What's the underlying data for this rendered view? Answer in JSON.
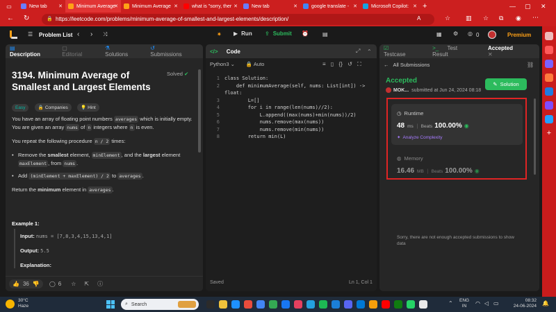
{
  "tabs": [
    {
      "label": "New tab",
      "fav": "#6b7cff"
    },
    {
      "label": "Minimum Average",
      "fav": "#ffa116",
      "active": true
    },
    {
      "label": "Minimum Average",
      "fav": "#ffa116"
    },
    {
      "label": "what is \"sorry, ther",
      "fav": "#ff0000"
    },
    {
      "label": "New tab",
      "fav": "#6b7cff"
    },
    {
      "label": "google translate -",
      "fav": "#4285f4"
    },
    {
      "label": "Microsoft Copilot:",
      "fav": "#17a2e0"
    }
  ],
  "address": {
    "url": "https://leetcode.com/problems/minimum-average-of-smallest-and-largest-elements/description/"
  },
  "nav": {
    "problem_list": "Problem List",
    "run": "Run",
    "submit": "Submit",
    "streak": "0",
    "premium": "Premium"
  },
  "desc_tabs": {
    "description": "Description",
    "editorial": "Editorial",
    "solutions": "Solutions",
    "submissions": "Submissions"
  },
  "problem": {
    "title_line1": "3194. Minimum Average of",
    "title_line2": "Smallest and Largest Elements",
    "solved": "Solved",
    "difficulty": "Easy",
    "companies": "Companies",
    "hint": "Hint",
    "p1a": "You have an array of floating point numbers ",
    "p1b": "averages",
    "p1c": " which is initially empty. You are given an array ",
    "p1d": "nums",
    "p1e": " of ",
    "p1f": "n",
    "p1g": " integers where ",
    "p1h": "n",
    "p1i": " is even.",
    "p2a": "You repeat the following procedure ",
    "p2b": "n / 2",
    "p2c": " times:",
    "b1a": "Remove the ",
    "b1b": "smallest",
    "b1c": " element, ",
    "b1d": "minElement",
    "b1e": ", and the ",
    "b1f": "largest",
    "b1g": " element ",
    "b1h": "maxElement",
    "b1i": ", from ",
    "b1j": "nums",
    "b1k": ".",
    "b2a": "Add ",
    "b2b": "(minElement + maxElement) / 2",
    "b2c": " to ",
    "b2d": "averages",
    "b2e": ".",
    "p3a": "Return the ",
    "p3b": "minimum",
    "p3c": " element in ",
    "p3d": "averages",
    "p3e": ".",
    "example": "Example 1:",
    "input_label": "Input:",
    "input_val": "nums = [7,8,3,4,15,13,4,1]",
    "output_label": "Output:",
    "output_val": "5.5",
    "explanation": "Explanation:",
    "likes": "36",
    "comments": "6"
  },
  "code": {
    "tab": "Code",
    "lang": "Python3",
    "auto": "Auto",
    "lines": [
      "class Solution:",
      "    def minimumAverage(self, nums: List[int]) ->",
      "float:",
      "        L=[]",
      "        for i in range(len(nums)//2):",
      "            L.append((max(nums)+min(nums))/2)",
      "            nums.remove(max(nums))",
      "            nums.remove(min(nums))",
      "        return min(L)"
    ],
    "line_nums": [
      "1",
      "2",
      "",
      "3",
      "4",
      "5",
      "6",
      "7",
      "8"
    ],
    "saved": "Saved",
    "cursor": "Ln 1, Col 1"
  },
  "result": {
    "tab_testcase": "Testcase",
    "tab_testresult": "Test Result",
    "tab_accepted": "Accepted",
    "all_submissions": "All Submissions",
    "status": "Accepted",
    "user": "MOK...",
    "submitted": "submitted at Jun 24, 2024 08:18",
    "solution_btn": "Solution",
    "runtime_label": "Runtime",
    "runtime_val": "48",
    "runtime_unit": "ms",
    "beats_label": "Beats",
    "runtime_beats": "100.00%",
    "analyze": "Analyze Complexity",
    "memory_label": "Memory",
    "memory_val": "16.46",
    "memory_unit": "MB",
    "memory_beats": "100.00%",
    "no_data": "Sorry, there are not enough accepted submissions to show data"
  },
  "taskbar": {
    "temp": "30°C",
    "weather": "Haze",
    "search": "Search",
    "lang1": "ENG",
    "lang2": "IN",
    "time": "08:32",
    "date": "24-06-2024"
  },
  "colors": {
    "accent": "#ffa116",
    "green": "#2cbb5d",
    "highlight": "#e02424",
    "easy": "#00b8a3"
  }
}
